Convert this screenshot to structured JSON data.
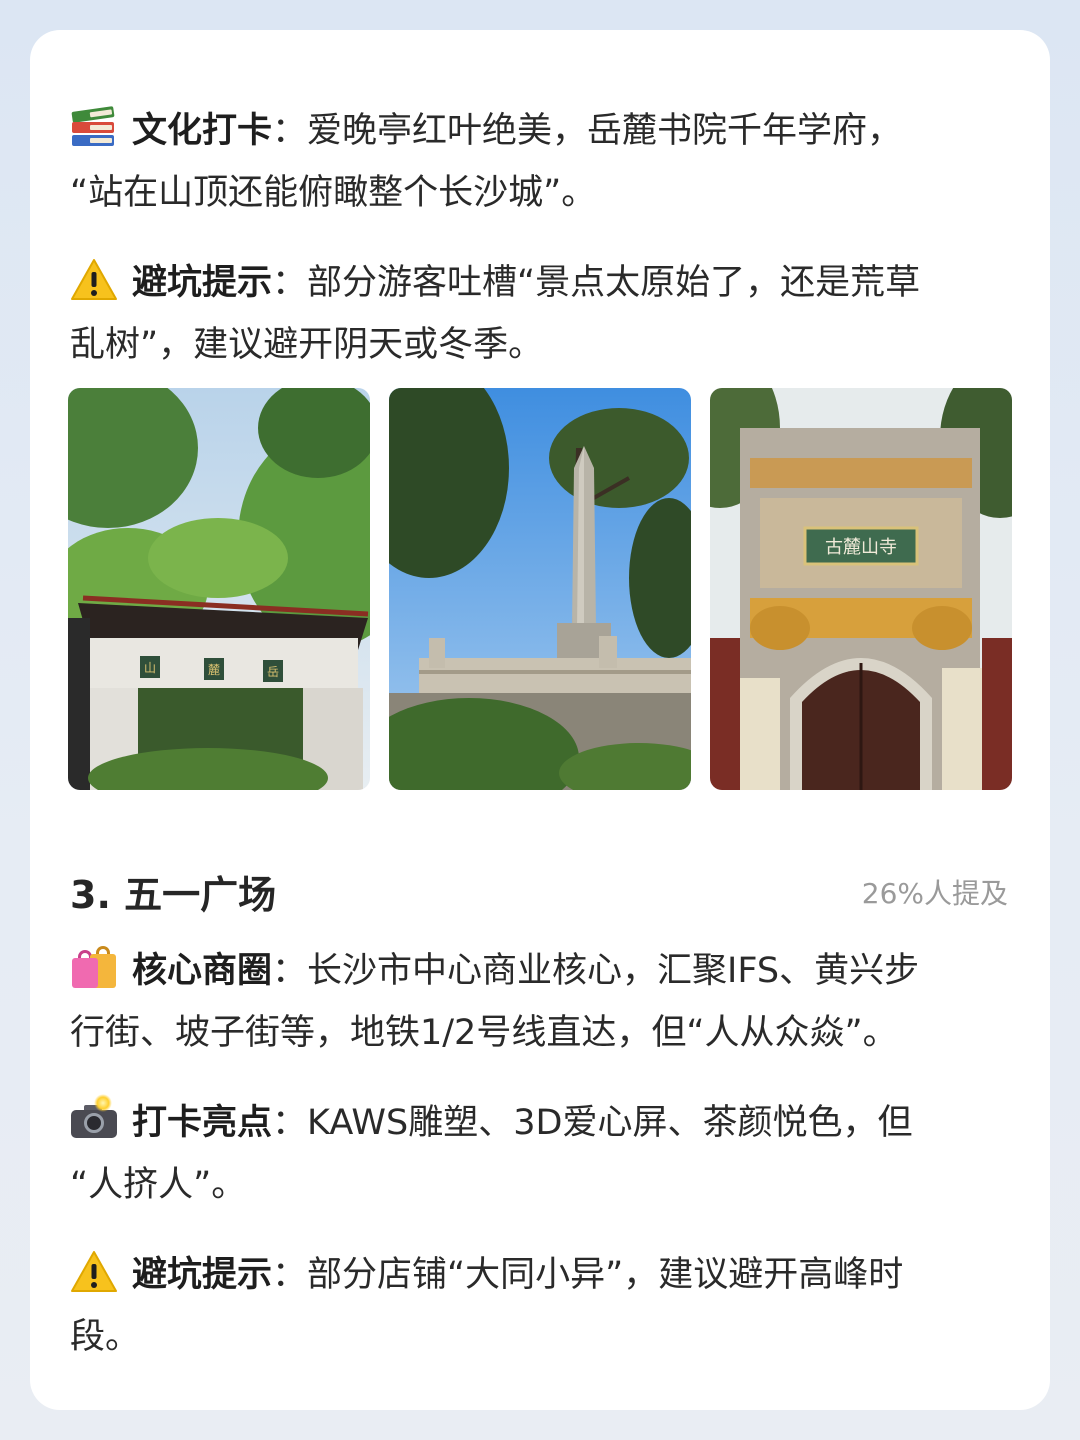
{
  "culture": {
    "icon": "books-icon",
    "label": "文化打卡",
    "sep": "：",
    "text_line1": "爱晚亭红叶绝美，岳麓书院千年学府，",
    "text_line2": "“站在山顶还能俯瞰整个长沙城”。"
  },
  "tip1": {
    "icon": "warning-icon",
    "label": "避坑提示",
    "sep": "：",
    "text_line1": "部分游客吐槽“景点太原始了，还是荒草",
    "text_line2": "乱树”，建议避开阴天或冬季。"
  },
  "photos": [
    {
      "name": "gate-photo",
      "sign": [
        "山",
        "麓",
        "岳"
      ]
    },
    {
      "name": "monument-photo"
    },
    {
      "name": "temple-photo",
      "plaque": "古麓山寺"
    }
  ],
  "section": {
    "title": "3. 五一广场",
    "mention": "26%人提及"
  },
  "core": {
    "icon": "shopping-bags-icon",
    "label": "核心商圈",
    "sep": "：",
    "text_line1": "长沙市中心商业核心，汇聚IFS、黄兴步",
    "text_line2": "行街、坡子街等，地铁1/2号线直达，但“人从众焱”。"
  },
  "highlight": {
    "icon": "camera-flash-icon",
    "label": "打卡亮点",
    "sep": "：",
    "text_line1": "KAWS雕塑、3D爱心屏、茶颜悦色，但",
    "text_line2": "“人挤人”。"
  },
  "tip2": {
    "icon": "warning-icon",
    "label": "避坑提示",
    "sep": "：",
    "text_line1": "部分店铺“大同小异”，建议避开高峰时",
    "text_line2": "段。"
  }
}
